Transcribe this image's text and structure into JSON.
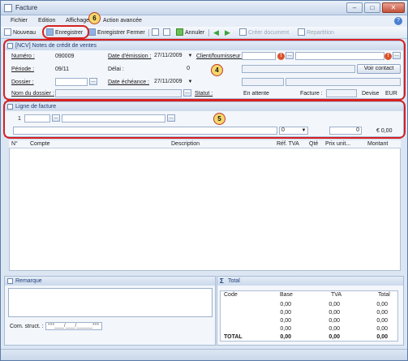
{
  "window": {
    "title": "Facture",
    "btn_min": "–",
    "btn_max": "□",
    "btn_close": "✕"
  },
  "menu": {
    "fichier": "Fichier",
    "edition": "Edition",
    "affichage": "Affichage",
    "action": "Action avancée",
    "help": "?"
  },
  "toolbar": {
    "nouveau": "Nouveau",
    "enregistrer": "Enregistrer",
    "enregistrer_fermer": "Enregistrer Fermer",
    "annuler": "Annuler",
    "creer_document": "Créer document",
    "repartition": "Repartition"
  },
  "header_panel": {
    "title": "[NCV] Notes de crédit de ventes",
    "numero_label": "Numéro :",
    "numero_value": "090009",
    "periode_label": "Période :",
    "periode_value": "09/11",
    "dossier_label": "Dossier :",
    "dossier_value": "",
    "nom_dossier_label": "Nom du dossier :",
    "nom_dossier_value": "",
    "date_emission_label": "Date d'émission :",
    "date_emission_value": "27/11/2009",
    "delai_label": "Délai :",
    "delai_value": "0",
    "date_echeance_label": "Date échéance :",
    "date_echeance_value": "27/11/2009",
    "client_label": "Client/fournisseur :",
    "client_value": "",
    "voir_contact": "Voir contact",
    "statut_label": "Statut :",
    "statut_value": "En attente",
    "facture_label": "Facture :",
    "facture_value": "",
    "devise_label": "Devise",
    "devise_value": "EUR"
  },
  "line_panel": {
    "title": "Ligne de facture",
    "line_no": "1",
    "dropdown_value": "0",
    "amount_value": "0",
    "amount_total": "€ 0,00"
  },
  "grid": {
    "columns": [
      "N°",
      "Compte",
      "Description",
      "Réf. TVA",
      "Qté",
      "Prix unit...",
      "Montant"
    ]
  },
  "remark_panel": {
    "title": "Remarque",
    "comm_label": "Com. struct. :",
    "comm_value": "***___/___/_____***"
  },
  "total_panel": {
    "title": "Total",
    "headers": [
      "Code",
      "Base",
      "TVA",
      "Total"
    ],
    "rows": [
      [
        "0,00",
        "0,00",
        "0,00"
      ],
      [
        "0,00",
        "0,00",
        "0,00"
      ],
      [
        "0,00",
        "0,00",
        "0,00"
      ],
      [
        "0,00",
        "0,00",
        "0,00"
      ]
    ],
    "total_label": "TOTAL",
    "total_row": [
      "0,00",
      "0,00",
      "0,00"
    ]
  },
  "callouts": {
    "c4": "4",
    "c5": "5",
    "c6": "6"
  },
  "colors": {
    "callout_ring": "#d62020",
    "callout_fill": "#f5d76b",
    "header_text": "#1c3d78"
  }
}
